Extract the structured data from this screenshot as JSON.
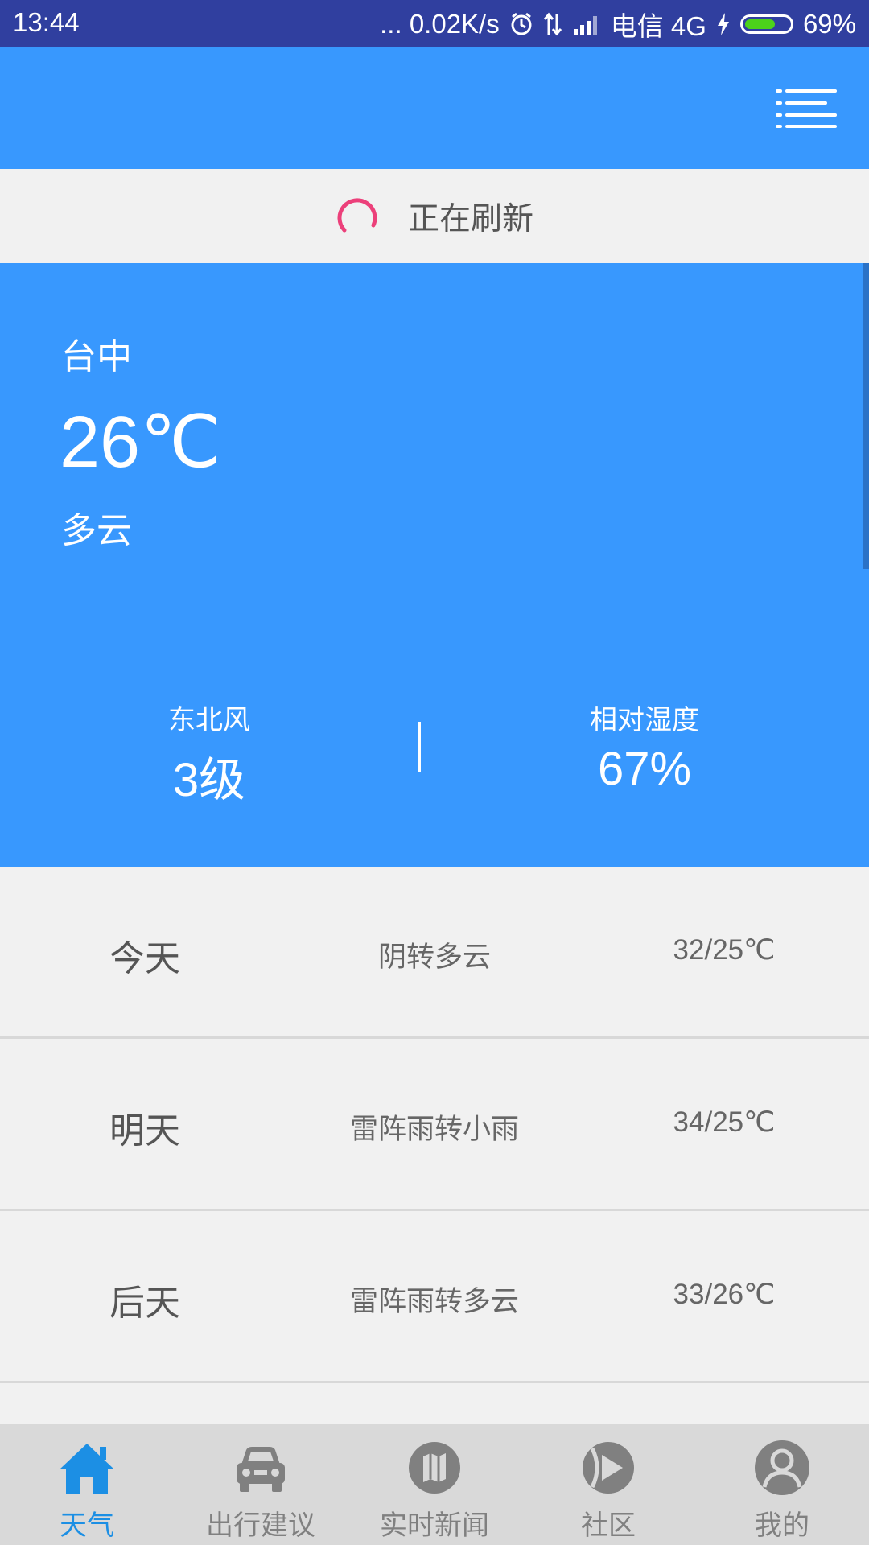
{
  "status_bar": {
    "time": "13:44",
    "net_speed": "... 0.02K/s",
    "carrier": "电信 4G",
    "battery": "69%",
    "battery_level": 0.69
  },
  "refresh": {
    "text": "正在刷新",
    "accent_color": "#ec407a"
  },
  "current": {
    "city": "台中",
    "temperature": "26℃",
    "condition": "多云",
    "wind_label": "东北风",
    "wind_value": "3级",
    "humidity_label": "相对湿度",
    "humidity_value": "67%"
  },
  "forecast": [
    {
      "day": "今天",
      "desc": "阴转多云",
      "range": "32/25℃"
    },
    {
      "day": "明天",
      "desc": "雷阵雨转小雨",
      "range": "34/25℃"
    },
    {
      "day": "后天",
      "desc": "雷阵雨转多云",
      "range": "33/26℃"
    }
  ],
  "nav": [
    {
      "label": "天气",
      "icon": "home-icon",
      "active": true
    },
    {
      "label": "出行建议",
      "icon": "car-icon"
    },
    {
      "label": "实时新闻",
      "icon": "map-icon"
    },
    {
      "label": "社区",
      "icon": "community-icon"
    },
    {
      "label": "我的",
      "icon": "user-icon"
    }
  ],
  "colors": {
    "primary": "#3898fe",
    "status_bar": "#303f9f",
    "nav_active": "#1c8fe4",
    "nav_inactive": "#808080"
  }
}
